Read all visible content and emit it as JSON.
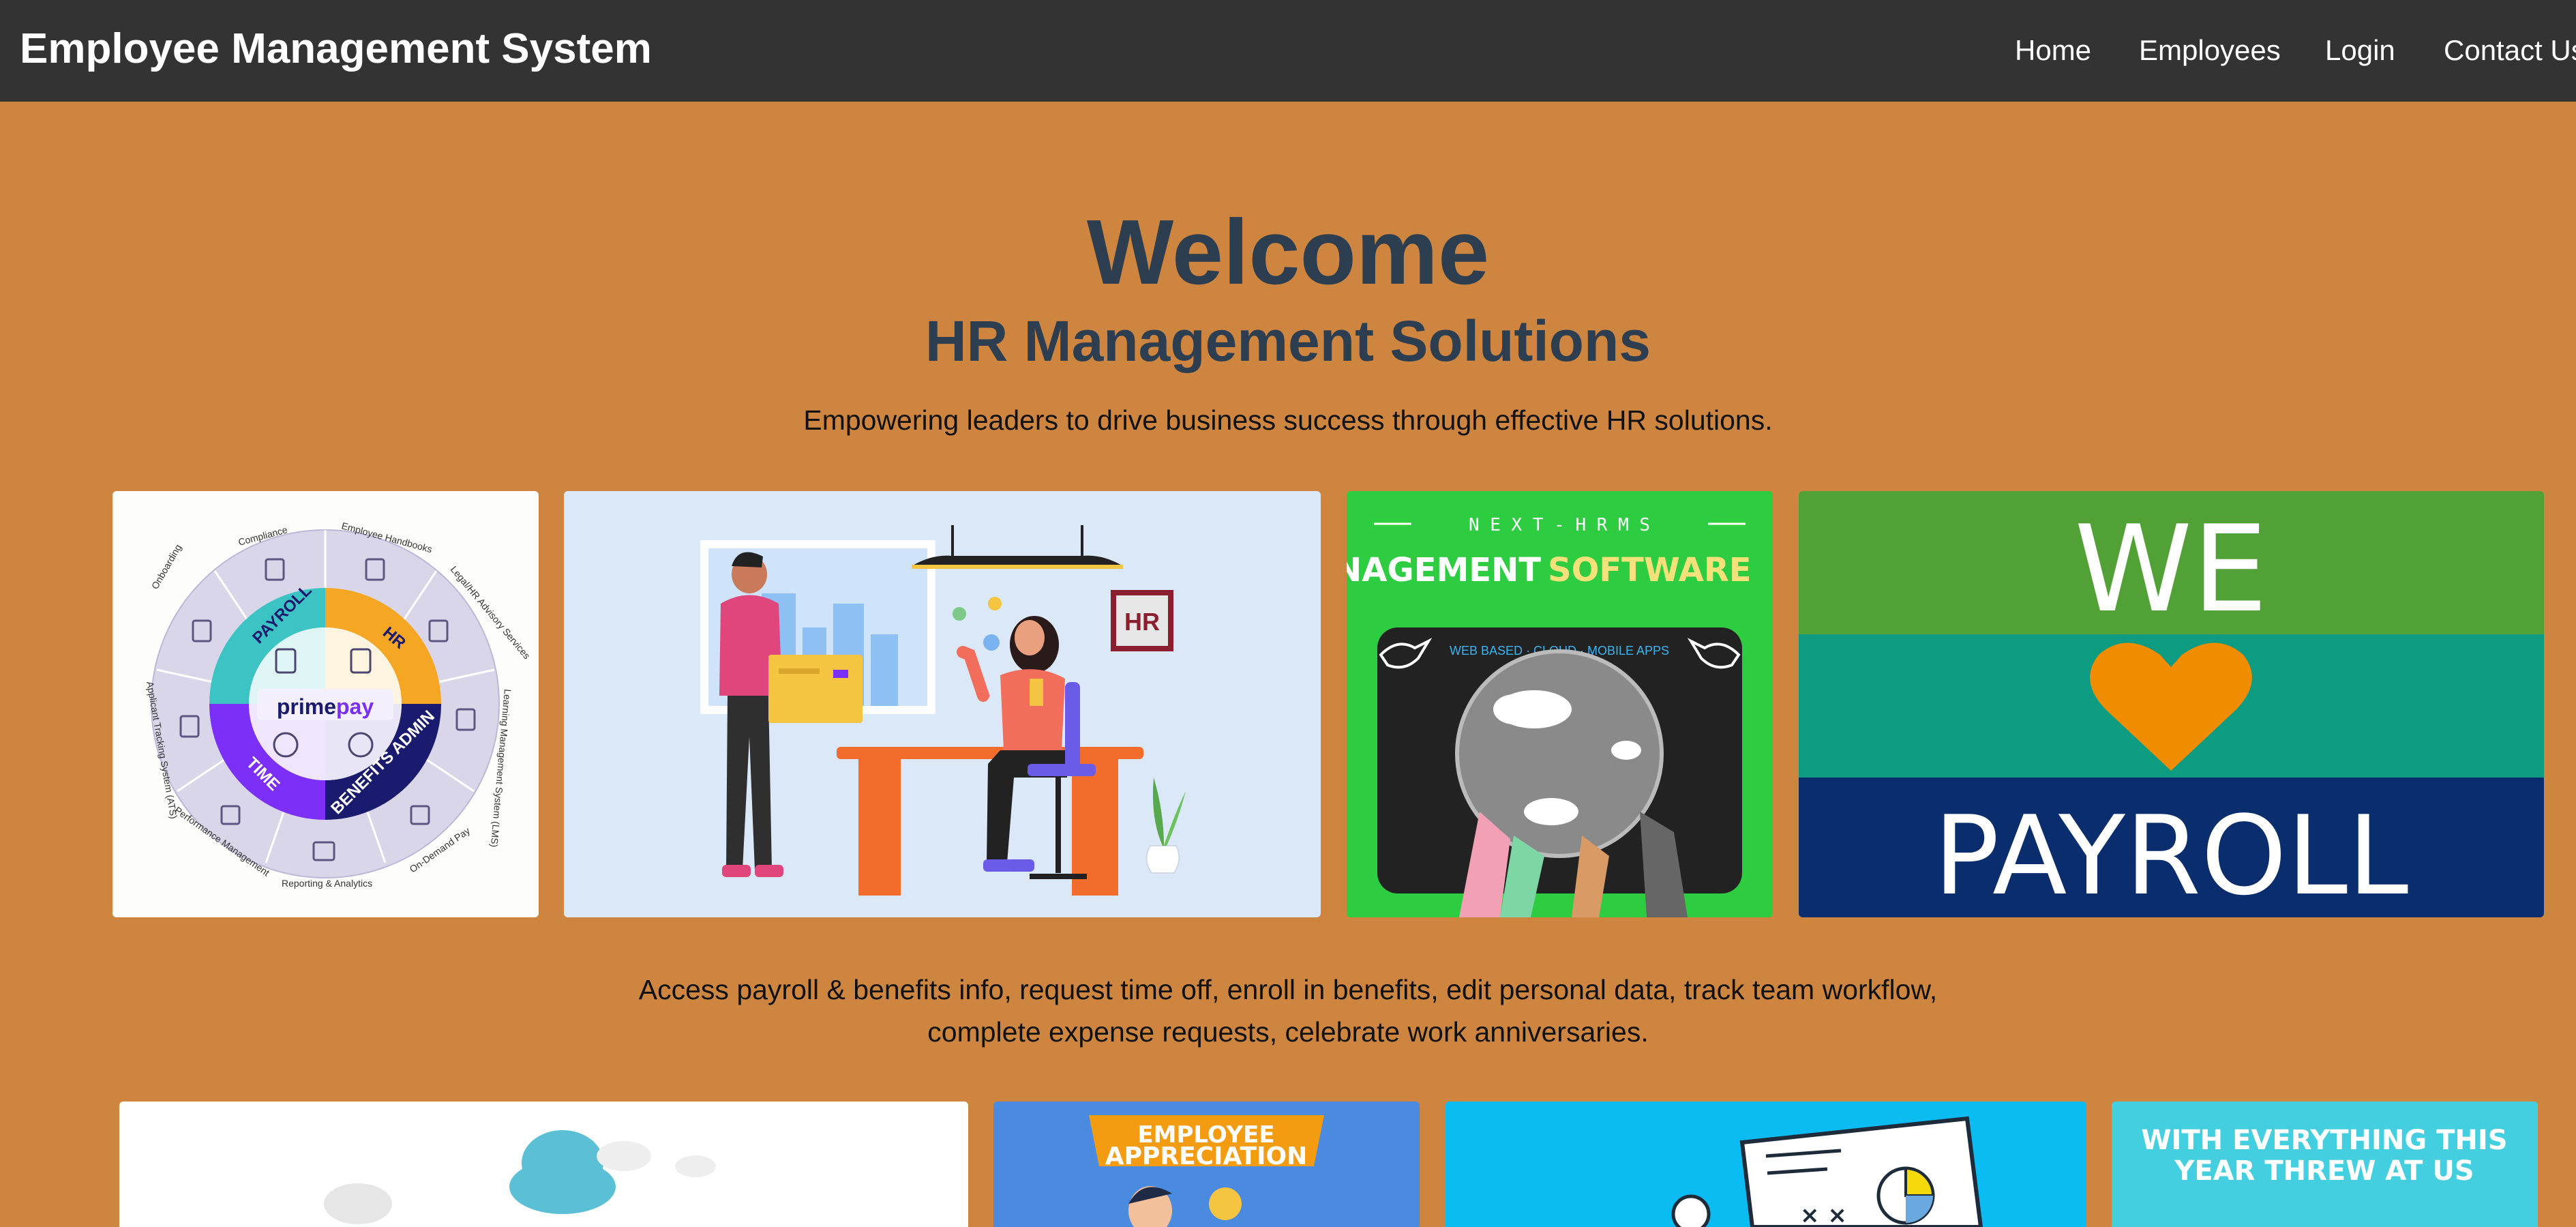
{
  "navbar": {
    "brand": "Employee Management System",
    "links": [
      "Home",
      "Employees",
      "Login",
      "Contact Us"
    ]
  },
  "hero": {
    "title": "Welcome",
    "subtitle": "HR Management Solutions",
    "tagline": "Empowering leaders to drive business success through effective HR solutions."
  },
  "wheel": {
    "brand_prefix": "prime",
    "brand_suffix": "pay",
    "segments": [
      "PAYROLL",
      "HR",
      "BENEFITS ADMIN",
      "TIME"
    ],
    "outer_labels": [
      "Compliance",
      "Employee Handbooks",
      "Legal/HR Advisory Services",
      "Learning Management System (LMS)",
      "On-Demand Pay",
      "Reporting & Analytics",
      "Performance Management",
      "Applicant Tracking System (ATS)",
      "Onboarding"
    ]
  },
  "hrms_card": {
    "top": "N E X T  -  H R M S",
    "title_white": "HR MANAGEMENT",
    "title_yellow": "SOFTWARE",
    "arc": "WEB BASED · CLOUD · MOBILE APPS"
  },
  "office_card": {
    "sign": "HR"
  },
  "payroll_card": {
    "top": "WE",
    "bottom": "PAYROLL"
  },
  "info_line1": "Access payroll & benefits info, request time off, enroll in benefits, edit personal data, track team workflow,",
  "info_line2": "complete expense requests, celebrate work anniversaries.",
  "bottom_cards": {
    "appreciation_line1": "EMPLOYEE",
    "appreciation_line2": "APPRECIATION",
    "year_line1": "WITH EVERYTHING THIS",
    "year_line2": "YEAR THREW AT US"
  },
  "colors": {
    "background": "#CD853F",
    "navbar": "#333333",
    "heading": "#2c3e50"
  }
}
